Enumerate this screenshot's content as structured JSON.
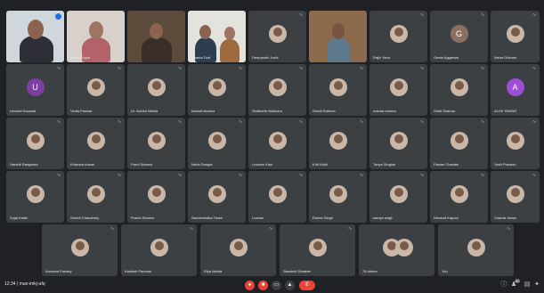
{
  "meeting": {
    "time": "12:34",
    "separator": "|",
    "code": "mue-imkj-ufq",
    "participant_count": "60"
  },
  "icons": {
    "mic_off": "mic-off-icon",
    "cam_off": "camera-off-icon",
    "captions": "captions-icon",
    "present": "present-icon",
    "end_call": "end-call-icon",
    "info": "info-icon",
    "people": "people-icon",
    "chat": "chat-icon",
    "activities": "activities-icon"
  },
  "colors": {
    "background": "#202124",
    "tile": "#3c4043",
    "end_call": "#ea4335",
    "pin": "#1a73e8"
  },
  "row1": [
    {
      "name": "",
      "type": "video1"
    },
    {
      "name": "Arpita Gupta",
      "type": "video2"
    },
    {
      "name": "",
      "type": "video3"
    },
    {
      "name": "Ananta Dutt",
      "type": "video4"
    },
    {
      "name": "Deepanshi Joshi",
      "type": "avatar"
    },
    {
      "name": "",
      "type": "video5"
    },
    {
      "name": "Rajiv Yadu",
      "type": "avatar"
    },
    {
      "name": "Geeta Aggarwal",
      "type": "letter",
      "letter": "G",
      "color": "#8d6e63"
    },
    {
      "name": "Nisha Dhiman",
      "type": "avatar"
    }
  ],
  "row2": [
    {
      "name": "Urvashi Kaushal",
      "type": "letter",
      "letter": "U",
      "color": "#7b3fa4"
    },
    {
      "name": "Vinita Panwar",
      "type": "avatar"
    },
    {
      "name": "Dr. Ashish Mehta",
      "type": "avatar"
    },
    {
      "name": "harshit sharma",
      "type": "avatar"
    },
    {
      "name": "Siddharth Malhotra",
      "type": "avatar"
    },
    {
      "name": "Shruti Rathore",
      "type": "avatar"
    },
    {
      "name": "mamta meena",
      "type": "avatar"
    },
    {
      "name": "Sristi Sharma",
      "type": "avatar"
    },
    {
      "name": "ALOK RAWAT",
      "type": "letter",
      "letter": "A",
      "color": "#9c4ed6"
    }
  ],
  "row3": [
    {
      "name": "Harshit Rangwani",
      "type": "avatar"
    },
    {
      "name": "Khanam Ansari",
      "type": "avatar"
    },
    {
      "name": "Parul Sharma",
      "type": "avatar"
    },
    {
      "name": "Neha Dangar",
      "type": "avatar"
    },
    {
      "name": "Lovleen Kaur",
      "type": "avatar"
    },
    {
      "name": "Kriti Kohli",
      "type": "avatar"
    },
    {
      "name": "Tanya Singhal",
      "type": "avatar"
    },
    {
      "name": "Pawan Chandel",
      "type": "avatar"
    },
    {
      "name": "Yash Prakash",
      "type": "avatar"
    }
  ],
  "row4": [
    {
      "name": "Sujal Kadiri",
      "type": "avatar"
    },
    {
      "name": "Surbhi Chaudhary",
      "type": "avatar"
    },
    {
      "name": "Prachi Sharma",
      "type": "avatar"
    },
    {
      "name": "Sarvshrestha Tiwari",
      "type": "avatar"
    },
    {
      "name": "Loshan",
      "type": "avatar"
    },
    {
      "name": "Rohan Singh",
      "type": "avatar"
    },
    {
      "name": "samya singh",
      "type": "avatar"
    },
    {
      "name": "Nimarat Kapoor",
      "type": "avatar"
    },
    {
      "name": "Chahat Yadav",
      "type": "avatar"
    }
  ],
  "row5": [
    {
      "name": "Archana Pandey",
      "type": "avatar"
    },
    {
      "name": "Kashish Panchal",
      "type": "avatar"
    },
    {
      "name": "Riya Mehta",
      "type": "avatar"
    },
    {
      "name": "Sanskriti Dhaleen",
      "type": "avatar"
    },
    {
      "name": "78 others",
      "type": "others"
    },
    {
      "name": "You",
      "type": "avatar"
    }
  ]
}
